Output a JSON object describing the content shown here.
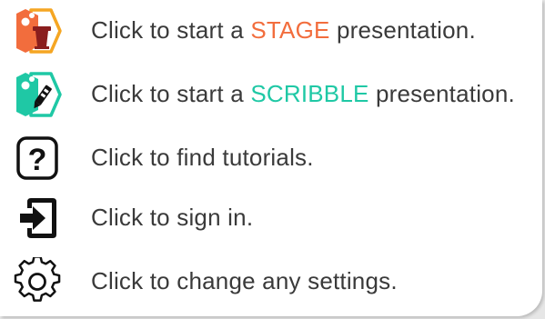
{
  "colors": {
    "stage_accent": "#f26d3d",
    "scribble_accent": "#1fc8a5",
    "text": "#3a3a3a",
    "icon_dark": "#111111"
  },
  "menu": {
    "items": [
      {
        "icon": "stage-podium-icon",
        "prefix": "Click to start a ",
        "highlight": "STAGE",
        "suffix": " presentation."
      },
      {
        "icon": "scribble-pen-icon",
        "prefix": "Click to start a ",
        "highlight": "SCRIBBLE",
        "suffix": " presentation."
      },
      {
        "icon": "question-mark-icon",
        "label": "Click to find tutorials."
      },
      {
        "icon": "sign-in-icon",
        "label": "Click to sign in."
      },
      {
        "icon": "gear-icon",
        "label": "Click to change any settings."
      }
    ]
  }
}
